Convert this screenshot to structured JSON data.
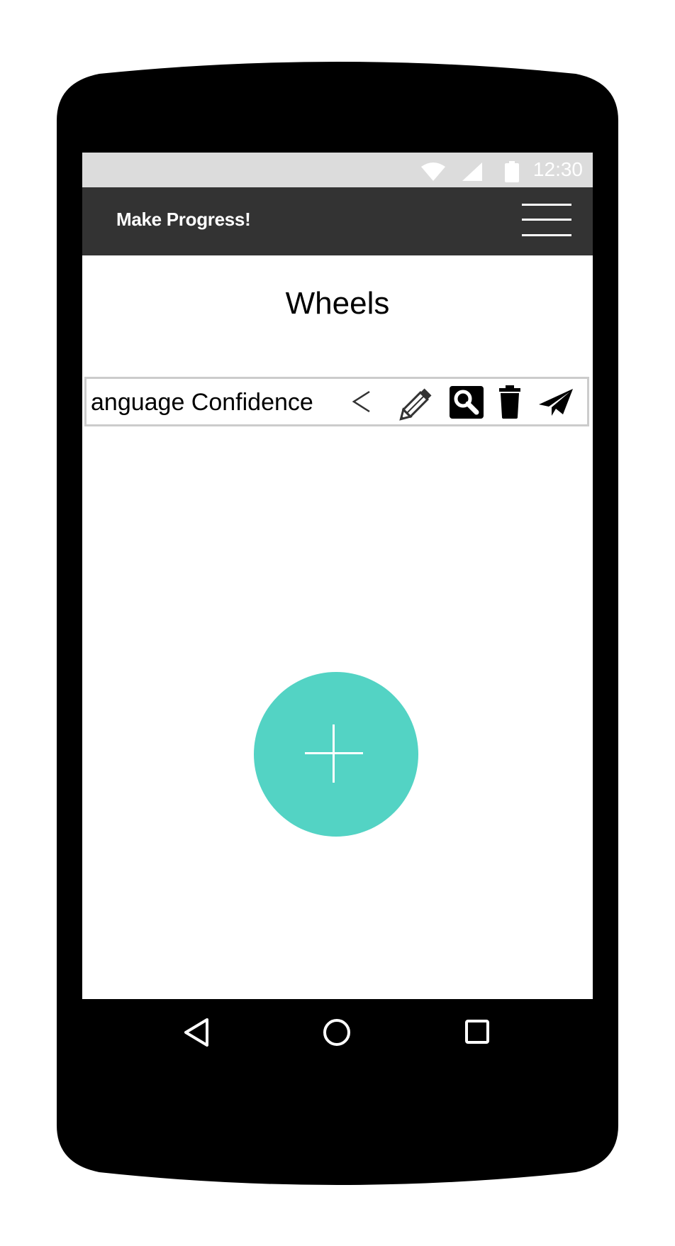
{
  "status_bar": {
    "time": "12:30",
    "icons": [
      "wifi-icon",
      "signal-icon",
      "battery-icon"
    ]
  },
  "app_bar": {
    "title": "Make Progress!",
    "menu_icon": "hamburger-menu-icon"
  },
  "page": {
    "title": "Wheels"
  },
  "wheels": [
    {
      "name": "anguage Confidence",
      "actions": [
        "chevron-left-icon",
        "pencil-icon",
        "search-icon",
        "trash-icon",
        "paper-plane-icon"
      ]
    }
  ],
  "fab": {
    "icon": "plus-icon",
    "color": "#53d3c4"
  },
  "nav_bar": {
    "buttons": [
      "back-triangle-icon",
      "home-circle-icon",
      "recents-square-icon"
    ]
  },
  "colors": {
    "app_bar": "#333333",
    "status_bar": "#dcdcdc",
    "accent": "#53d3c4"
  }
}
